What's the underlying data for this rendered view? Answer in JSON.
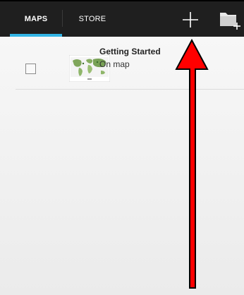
{
  "tabs": [
    {
      "label": "MAPS",
      "selected": true
    },
    {
      "label": "STORE",
      "selected": false
    }
  ],
  "toolbar": {
    "add_icon": "plus-icon",
    "folder_icon": "folder-add-icon"
  },
  "maps_list": [
    {
      "title": "Getting Started",
      "subtitle": "On map",
      "checked": false,
      "thumbnail_icon": "world-map-thumbnail"
    }
  ],
  "colors": {
    "accent": "#33b5e5",
    "arrow": "#ff0000",
    "topbar": "#1f1f1f"
  }
}
